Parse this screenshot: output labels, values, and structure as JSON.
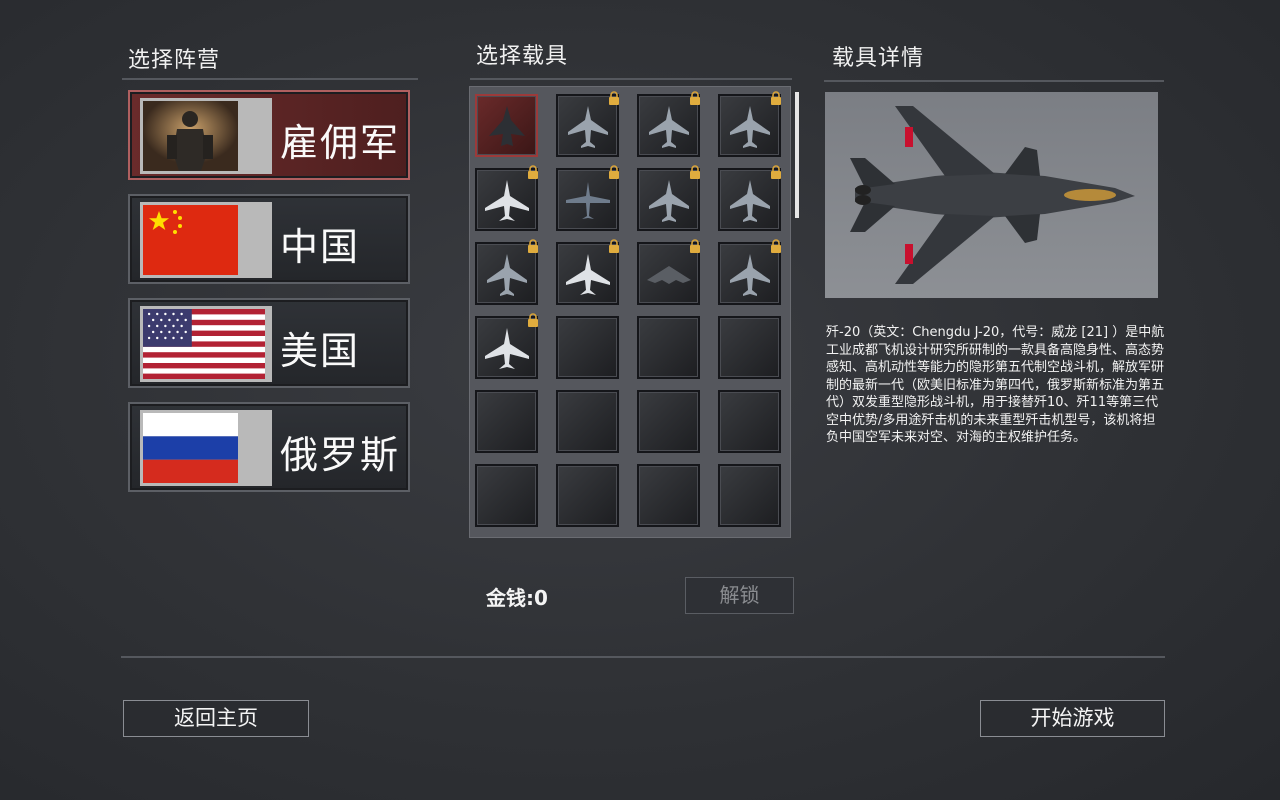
{
  "headers": {
    "faction": "选择阵营",
    "vehicle": "选择载具",
    "detail": "载具详情"
  },
  "factions": [
    {
      "label": "雇佣军",
      "selected": true
    },
    {
      "label": "中国",
      "selected": false
    },
    {
      "label": "美国",
      "selected": false
    },
    {
      "label": "俄罗斯",
      "selected": false
    }
  ],
  "vehicles": [
    {
      "locked": false,
      "selected": true,
      "icon": "stealth-fighter"
    },
    {
      "locked": true,
      "icon": "fighter"
    },
    {
      "locked": true,
      "icon": "fighter"
    },
    {
      "locked": true,
      "icon": "fighter"
    },
    {
      "locked": true,
      "icon": "bomber"
    },
    {
      "locked": true,
      "icon": "transport"
    },
    {
      "locked": true,
      "icon": "fighter"
    },
    {
      "locked": true,
      "icon": "fighter"
    },
    {
      "locked": true,
      "icon": "fighter"
    },
    {
      "locked": true,
      "icon": "bomber"
    },
    {
      "locked": true,
      "icon": "stealth-bomber"
    },
    {
      "locked": true,
      "icon": "fighter"
    },
    {
      "locked": true,
      "icon": "bomber"
    },
    {
      "locked": false,
      "icon": "empty"
    },
    {
      "locked": false,
      "icon": "empty"
    },
    {
      "locked": false,
      "icon": "empty"
    },
    {
      "locked": false,
      "icon": "empty"
    },
    {
      "locked": false,
      "icon": "empty"
    },
    {
      "locked": false,
      "icon": "empty"
    },
    {
      "locked": false,
      "icon": "empty"
    },
    {
      "locked": false,
      "icon": "empty"
    },
    {
      "locked": false,
      "icon": "empty"
    },
    {
      "locked": false,
      "icon": "empty"
    },
    {
      "locked": false,
      "icon": "empty"
    }
  ],
  "money_label": "金钱:0",
  "unlock_label": "解锁",
  "detail": {
    "description": "歼-20（英文：Chengdu J-20，代号：威龙 [21] ）是中航工业成都飞机设计研究所研制的一款具备高隐身性、高态势感知、高机动性等能力的隐形第五代制空战斗机，解放军研制的最新一代（欧美旧标准为第四代，俄罗斯新标准为第五代）双发重型隐形战斗机，用于接替歼10、歼11等第三代空中优势/多用途歼击机的未来重型歼击机型号，该机将担负中国空军未来对空、对海的主权维护任务。"
  },
  "buttons": {
    "back": "返回主页",
    "start": "开始游戏"
  },
  "colors": {
    "selected_faction": "#6a2b2b",
    "background": "#2f3135"
  }
}
